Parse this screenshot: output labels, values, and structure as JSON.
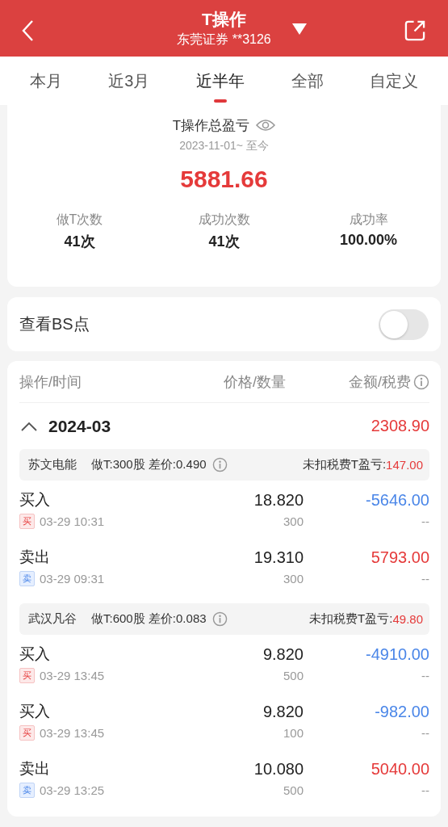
{
  "header": {
    "title": "T操作",
    "account": "东莞证券 **3126"
  },
  "tabs": [
    {
      "label": "本月",
      "selected": false
    },
    {
      "label": "近3月",
      "selected": false
    },
    {
      "label": "近半年",
      "selected": true
    },
    {
      "label": "全部",
      "selected": false
    },
    {
      "label": "自定义",
      "selected": false
    }
  ],
  "summary": {
    "title": "T操作总盈亏",
    "period": "2023-11-01~ 至今",
    "total": "5881.66",
    "stats": [
      {
        "label": "做T次数",
        "value": "41次"
      },
      {
        "label": "成功次数",
        "value": "41次"
      },
      {
        "label": "成功率",
        "value": "100.00%"
      }
    ]
  },
  "bs_toggle": {
    "label": "查看BS点",
    "on": false
  },
  "table": {
    "columns": [
      "操作/时间",
      "价格/数量",
      "金额/税费"
    ],
    "months": [
      {
        "month": "2024-03",
        "expanded": true,
        "total": "2308.90",
        "groups": [
          {
            "stock": "苏文电能",
            "detail": "做T:300股 差价:0.490",
            "pnl_label": "未扣税费T盈亏:",
            "pnl": "147.00",
            "trades": [
              {
                "kind": "buy",
                "action": "买入",
                "badge": "买",
                "time": "03-29 10:31",
                "price": "18.820",
                "qty": "300",
                "amount": "-5646.00",
                "fee": "--"
              },
              {
                "kind": "sell",
                "action": "卖出",
                "badge": "卖",
                "time": "03-29 09:31",
                "price": "19.310",
                "qty": "300",
                "amount": "5793.00",
                "fee": "--"
              }
            ]
          },
          {
            "stock": "武汉凡谷",
            "detail": "做T:600股 差价:0.083",
            "pnl_label": "未扣税费T盈亏:",
            "pnl": "49.80",
            "trades": [
              {
                "kind": "buy",
                "action": "买入",
                "badge": "买",
                "time": "03-29 13:45",
                "price": "9.820",
                "qty": "500",
                "amount": "-4910.00",
                "fee": "--"
              },
              {
                "kind": "buy",
                "action": "买入",
                "badge": "买",
                "time": "03-29 13:45",
                "price": "9.820",
                "qty": "100",
                "amount": "-982.00",
                "fee": "--"
              },
              {
                "kind": "sell",
                "action": "卖出",
                "badge": "卖",
                "time": "03-29 13:25",
                "price": "10.080",
                "qty": "500",
                "amount": "5040.00",
                "fee": "--"
              }
            ]
          }
        ]
      }
    ]
  }
}
